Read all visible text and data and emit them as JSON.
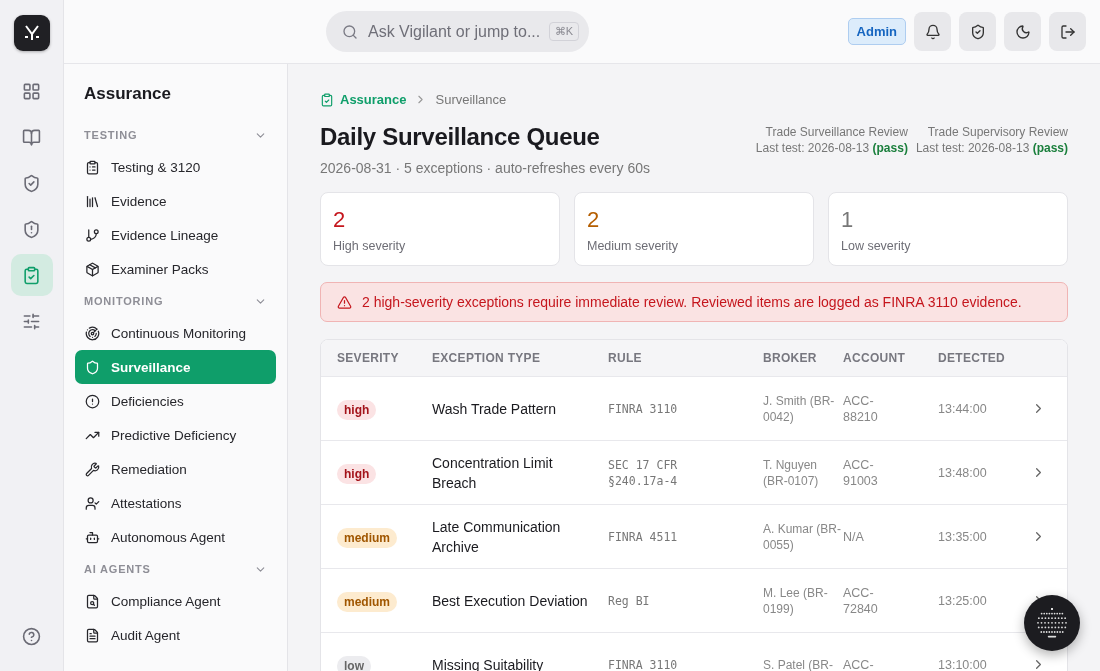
{
  "rail": [
    {
      "selected": false
    },
    {
      "selected": false
    },
    {
      "selected": false
    },
    {
      "selected": false
    },
    {
      "selected": true
    },
    {
      "selected": false
    }
  ],
  "search": {
    "placeholder": "Ask Vigilant or jump to...",
    "shortcut": "⌘K"
  },
  "role_badge": "Admin",
  "sidebar": {
    "title": "Assurance",
    "sections": [
      {
        "label": "TESTING",
        "expanded": true,
        "items": [
          {
            "label": "Testing & 3120",
            "selected": false
          },
          {
            "label": "Evidence",
            "selected": false
          },
          {
            "label": "Evidence Lineage",
            "selected": false
          },
          {
            "label": "Examiner Packs",
            "selected": false
          }
        ]
      },
      {
        "label": "MONITORING",
        "expanded": true,
        "items": [
          {
            "label": "Continuous Monitoring",
            "selected": false
          },
          {
            "label": "Surveillance",
            "selected": true
          },
          {
            "label": "Deficiencies",
            "selected": false
          },
          {
            "label": "Predictive Deficiency",
            "selected": false
          },
          {
            "label": "Remediation",
            "selected": false
          },
          {
            "label": "Attestations",
            "selected": false
          },
          {
            "label": "Autonomous Agent",
            "selected": false
          }
        ]
      },
      {
        "label": "AI AGENTS",
        "expanded": true,
        "items": [
          {
            "label": "Compliance Agent",
            "selected": false
          },
          {
            "label": "Audit Agent",
            "selected": false
          }
        ]
      }
    ]
  },
  "breadcrumb": [
    "Assurance",
    "Surveillance"
  ],
  "page": {
    "title": "Daily Surveillance Queue",
    "subtitle": "2026-08-31 · 5 exceptions · auto-refreshes every 60s"
  },
  "tests": [
    {
      "name": "Trade Surveillance Review",
      "last_test": "Last test: 2026-08-13",
      "result": "(pass)"
    },
    {
      "name": "Trade Supervisory Review",
      "last_test": "Last test: 2026-08-13",
      "result": "(pass)"
    }
  ],
  "stats": [
    {
      "value": "2",
      "label": "High severity",
      "kind": "high"
    },
    {
      "value": "2",
      "label": "Medium severity",
      "kind": "medium"
    },
    {
      "value": "1",
      "label": "Low severity",
      "kind": "low"
    }
  ],
  "alert": "2 high-severity exceptions require immediate review. Reviewed items are logged as FINRA 3110 evidence.",
  "table": {
    "columns": [
      "SEVERITY",
      "EXCEPTION TYPE",
      "RULE",
      "BROKER",
      "ACCOUNT",
      "DETECTED"
    ],
    "rows": [
      {
        "severity": "high",
        "type": "Wash Trade Pattern",
        "rule": "FINRA 3110",
        "broker": "J. Smith (BR-0042)",
        "account": "ACC-88210",
        "detected": "13:44:00"
      },
      {
        "severity": "high",
        "type": "Concentration Limit Breach",
        "rule": "SEC 17 CFR §240.17a-4",
        "broker": "T. Nguyen (BR-0107)",
        "account": "ACC-91003",
        "detected": "13:48:00"
      },
      {
        "severity": "medium",
        "type": "Late Communication Archive",
        "rule": "FINRA 4511",
        "broker": "A. Kumar (BR-0055)",
        "account": "N/A",
        "detected": "13:35:00"
      },
      {
        "severity": "medium",
        "type": "Best Execution Deviation",
        "rule": "Reg BI",
        "broker": "M. Lee (BR-0199)",
        "account": "ACC-72840",
        "detected": "13:25:00"
      },
      {
        "severity": "low",
        "type": "Missing Suitability",
        "rule": "FINRA 3110",
        "broker": "S. Patel (BR-",
        "account": "ACC-",
        "detected": "13:10:00"
      }
    ]
  }
}
